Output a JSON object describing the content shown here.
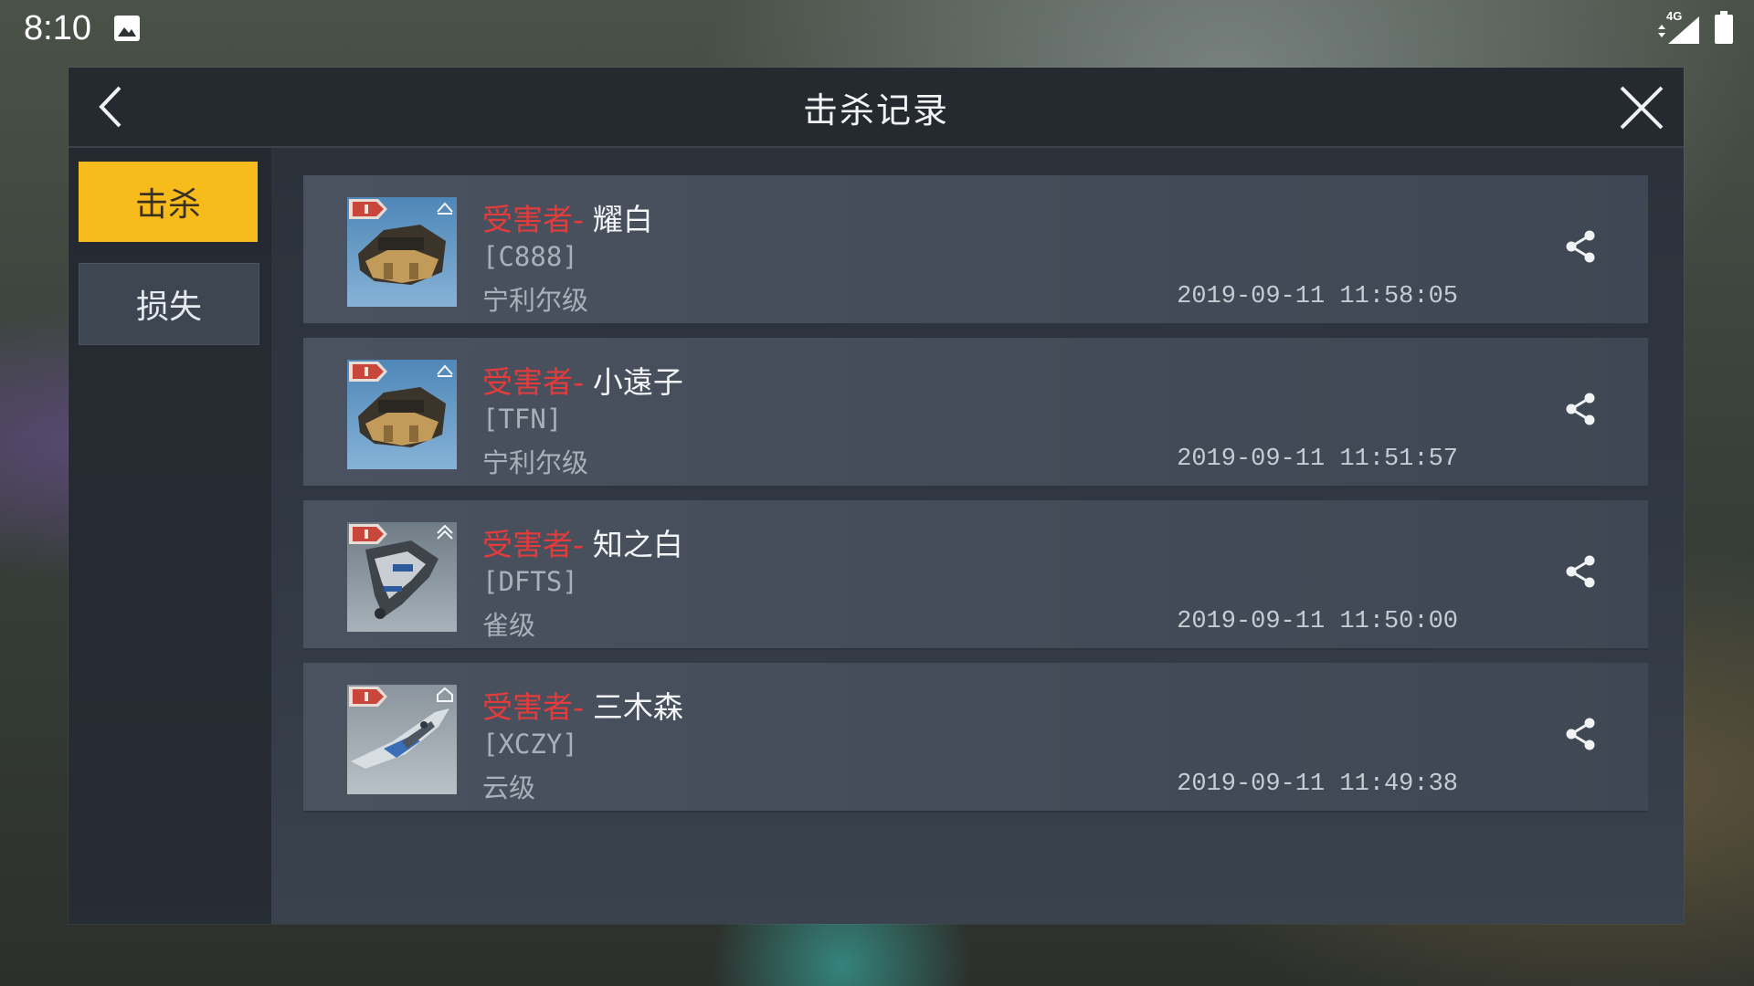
{
  "status_bar": {
    "time": "8:10",
    "network": "4G"
  },
  "dialog": {
    "title": "击杀记录"
  },
  "tabs": [
    {
      "label": "击杀",
      "active": true
    },
    {
      "label": "损失",
      "active": false
    }
  ],
  "records": [
    {
      "victim_label": "受害者-",
      "victim_name": "耀白",
      "corp": "[C888]",
      "ship_class": "宁利尔级",
      "time": "2019-09-11 11:58:05",
      "ship_icon": "heavy-cruiser-ship-icon"
    },
    {
      "victim_label": "受害者-",
      "victim_name": "小遠子",
      "corp": "[TFN]",
      "ship_class": "宁利尔级",
      "time": "2019-09-11 11:51:57",
      "ship_icon": "heavy-cruiser-ship-icon"
    },
    {
      "victim_label": "受害者-",
      "victim_name": "知之白",
      "corp": "[DFTS]",
      "ship_class": "雀级",
      "time": "2019-09-11 11:50:00",
      "ship_icon": "frigate-ship-icon"
    },
    {
      "victim_label": "受害者-",
      "victim_name": "三木森",
      "corp": "[XCZY]",
      "ship_class": "云级",
      "time": "2019-09-11 11:49:38",
      "ship_icon": "fighter-ship-icon"
    }
  ],
  "colors": {
    "accent": "#f7bb1c",
    "victim_label": "#e43b3b"
  }
}
